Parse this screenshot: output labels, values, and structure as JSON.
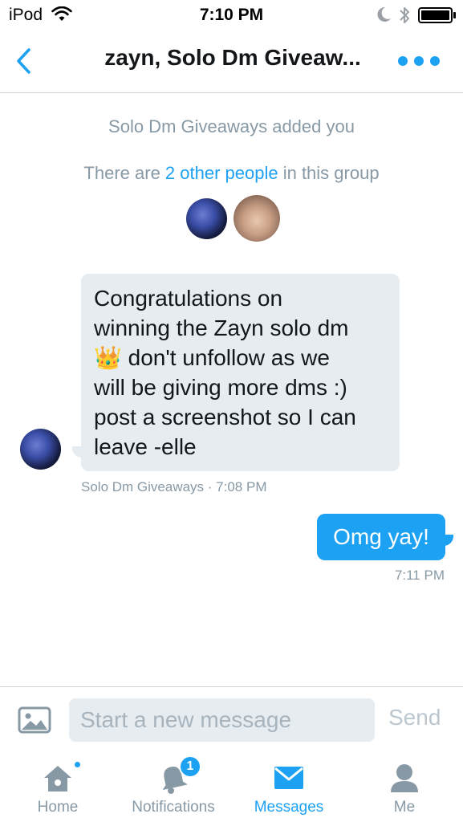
{
  "status_bar": {
    "carrier": "iPod",
    "time": "7:10 PM",
    "icons": [
      "wifi-icon",
      "moon-icon",
      "bluetooth-icon",
      "battery-icon"
    ]
  },
  "header": {
    "title": "zayn, Solo Dm Giveaw...",
    "back_icon": "chevron-left-icon",
    "more_icon": "more-dots-icon"
  },
  "conversation": {
    "added_notice": "Solo Dm Giveaways added you",
    "group_info": {
      "prefix": "There are ",
      "link": "2 other people",
      "suffix": " in this group"
    },
    "messages": [
      {
        "direction": "incoming",
        "text": "Congratulations on\nwinning the Zayn solo dm\n👑 don't unfollow as we\nwill be giving more dms :)\npost a screenshot so I can\nleave -elle",
        "sender": "Solo Dm Giveaways",
        "separator": " · ",
        "time": "7:08 PM"
      },
      {
        "direction": "outgoing",
        "text": "Omg yay!",
        "time": "7:11 PM"
      }
    ]
  },
  "composer": {
    "placeholder": "Start a new message",
    "send_label": "Send",
    "media_icon": "image-icon"
  },
  "tabs": [
    {
      "label": "Home",
      "icon": "home-icon",
      "badge_dot": true
    },
    {
      "label": "Notifications",
      "icon": "bell-icon",
      "badge_count": "1"
    },
    {
      "label": "Messages",
      "icon": "envelope-icon",
      "active": true
    },
    {
      "label": "Me",
      "icon": "person-icon"
    }
  ],
  "colors": {
    "accent": "#1da1f2",
    "bubble_incoming": "#e6ecf0",
    "muted_text": "#8899a6"
  }
}
